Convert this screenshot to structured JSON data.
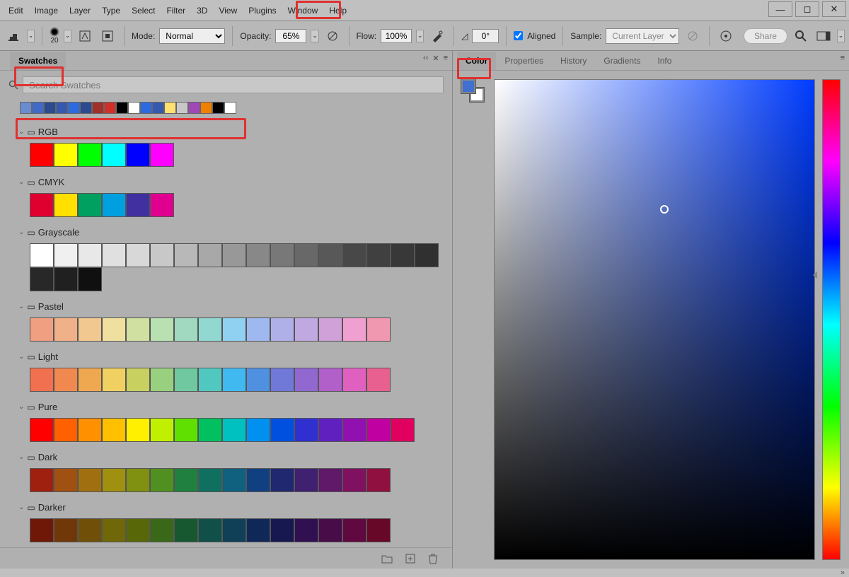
{
  "menu": [
    "Edit",
    "Image",
    "Layer",
    "Type",
    "Select",
    "Filter",
    "3D",
    "View",
    "Plugins",
    "Window",
    "Help"
  ],
  "options": {
    "brush_size": "20",
    "mode_label": "Mode:",
    "mode_value": "Normal",
    "opacity_label": "Opacity:",
    "opacity_value": "65%",
    "flow_label": "Flow:",
    "flow_value": "100%",
    "angle_value": "0°",
    "aligned_label": "Aligned",
    "sample_label": "Sample:",
    "sample_value": "Current Layer",
    "share_label": "Share"
  },
  "swatches": {
    "tab": "Swatches",
    "search_placeholder": "Search Swatches",
    "recent": [
      "#6a8bd0",
      "#3f6ac9",
      "#2b4a8f",
      "#3558b0",
      "#2c6ae0",
      "#2b4a8f",
      "#a03028",
      "#d03028",
      "#000000",
      "#ffffff",
      "#2c6ae0",
      "#3558b0",
      "#ffe070",
      "#c8c8c8",
      "#a048b8",
      "#f08000",
      "#000000",
      "#ffffff"
    ],
    "groups": [
      {
        "name": "RGB",
        "colors": [
          "#ff0000",
          "#ffff00",
          "#00ff00",
          "#00ffff",
          "#0000ff",
          "#ff00ff"
        ]
      },
      {
        "name": "CMYK",
        "colors": [
          "#e00030",
          "#ffe000",
          "#00a060",
          "#00a0e0",
          "#4030a0",
          "#e00090"
        ]
      },
      {
        "name": "Grayscale",
        "colors": [
          "#ffffff",
          "#f0f0f0",
          "#e8e8e8",
          "#e0e0e0",
          "#d8d8d8",
          "#c8c8c8",
          "#b8b8b8",
          "#a8a8a8",
          "#989898",
          "#888888",
          "#787878",
          "#686868",
          "#585858",
          "#484848",
          "#404040",
          "#383838",
          "#303030",
          "#282828",
          "#202020",
          "#101010"
        ]
      },
      {
        "name": "Pastel",
        "colors": [
          "#f0a080",
          "#f0b088",
          "#f0c890",
          "#f0e0a0",
          "#d0e0a0",
          "#b8e0b0",
          "#a0d8c0",
          "#90d8d0",
          "#90d0f0",
          "#a0b8f0",
          "#b0b0e8",
          "#c0a8e0",
          "#d0a0d8",
          "#f0a0d0",
          "#f098b0"
        ]
      },
      {
        "name": "Light",
        "colors": [
          "#f07050",
          "#f08850",
          "#f0a850",
          "#f0d060",
          "#c8d060",
          "#98d080",
          "#70c8a0",
          "#50c8c0",
          "#40b8f0",
          "#5090e0",
          "#7078d8",
          "#9068d0",
          "#b060c8",
          "#e060c0",
          "#e86090"
        ]
      },
      {
        "name": "Pure",
        "colors": [
          "#ff0000",
          "#ff6000",
          "#ff9000",
          "#ffc000",
          "#fff000",
          "#c0f000",
          "#60e000",
          "#00c060",
          "#00c0c0",
          "#0090f0",
          "#0050e0",
          "#3030d0",
          "#6020c0",
          "#9010b0",
          "#c000a0",
          "#e00060"
        ]
      },
      {
        "name": "Dark",
        "colors": [
          "#a02010",
          "#a05010",
          "#a07010",
          "#a09010",
          "#809010",
          "#509020",
          "#208040",
          "#107060",
          "#106080",
          "#104080",
          "#202870",
          "#402070",
          "#601868",
          "#801060",
          "#901040"
        ]
      },
      {
        "name": "Darker",
        "colors": [
          "#701808",
          "#703808",
          "#705008",
          "#706808",
          "#586808",
          "#386818",
          "#185830",
          "#105048",
          "#104058",
          "#102858",
          "#181850",
          "#301050",
          "#480c48",
          "#600840",
          "#680828"
        ]
      }
    ]
  },
  "colorpanel": {
    "tabs": [
      "Color",
      "Properties",
      "History",
      "Gradients",
      "Info"
    ],
    "active_tab": "Color"
  }
}
